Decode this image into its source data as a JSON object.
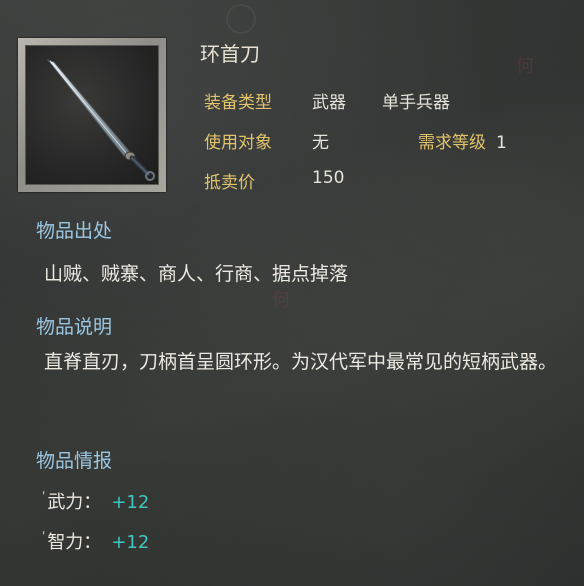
{
  "item": {
    "name": "环首刀",
    "icon": "sword-icon",
    "type_label": "装备类型",
    "type_value1": "武器",
    "type_value2": "单手兵器",
    "user_label": "使用对象",
    "user_value": "无",
    "req_label": "需求等级",
    "req_value": "1",
    "price_label": "抵卖价",
    "price_value": "150"
  },
  "sections": {
    "source_title": "物品出处",
    "source_text": "山贼、贼寨、商人、行商、据点掉落",
    "desc_title": "物品说明",
    "desc_text": "直脊直刃，刀柄首呈圆环形。为汉代军中最常见的短柄武器。",
    "info_title": "物品情报"
  },
  "stats": [
    {
      "label": "武力：",
      "value": "+12"
    },
    {
      "label": "智力：",
      "value": "+12"
    }
  ],
  "colors": {
    "gold_label": "#e0c36b",
    "section_title": "#9cc7e2",
    "stat_value": "#3fc6c0"
  }
}
